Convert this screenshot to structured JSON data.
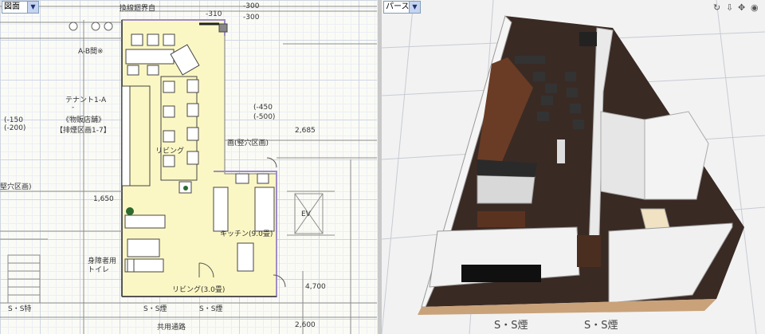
{
  "left_view": {
    "selector": "図面",
    "labels": {
      "tenant": "テナント1-A",
      "shop": "《物販店舗》",
      "fire_zone": "【排煙区画1-7】",
      "living1": "リビング",
      "kitchen": "キッチン(9.0畳)",
      "living2": "リビング(3.0畳)",
      "passage": "共用通路",
      "room_ab": "A-B間※",
      "ss1": "S・S特",
      "ss2": "S・S煙",
      "ss3": "S・S煙",
      "zone": "堅穴区画)",
      "zone2": "画(竪穴区画)",
      "dim_450": "(-450",
      "dim_500": "(-500)",
      "dim_150": "(-150",
      "dim_200": "(-200)",
      "dim_2685": "2,685",
      "dim_1650": "1,650",
      "dim_300a": "-300",
      "dim_300b": "-300",
      "dim_310": "-310",
      "dim_4700": "4,700",
      "dim_2600": "2,600",
      "ev": "EV",
      "toilet": "身障者用\nトイレ",
      "top_note": "換線廻界自"
    }
  },
  "right_view": {
    "selector": "パース",
    "toolbar": {
      "rotate_icon": "rotate-icon",
      "move_down_icon": "move-down-icon",
      "pan_icon": "pan-icon",
      "eye_icon": "eye-icon"
    },
    "labels": {
      "ss1": "S・S煙",
      "ss2": "S・S煙"
    }
  }
}
